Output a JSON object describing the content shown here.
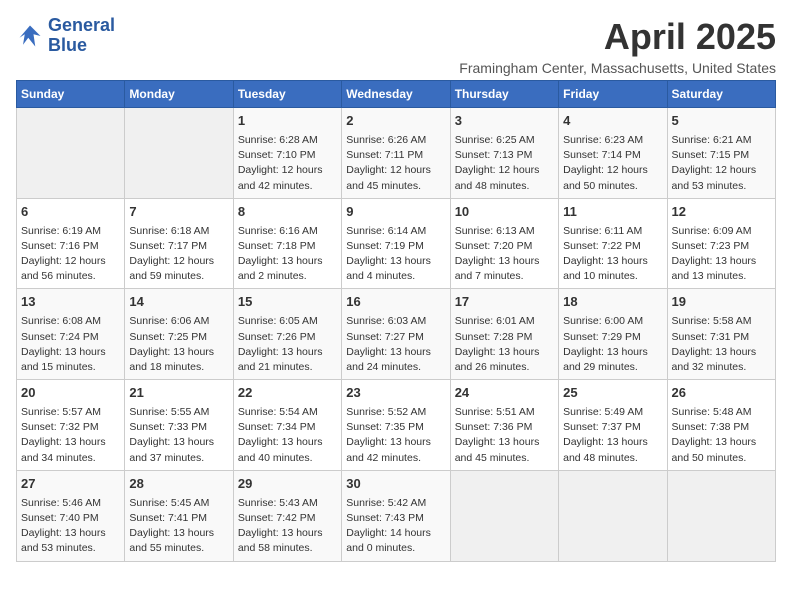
{
  "header": {
    "logo_line1": "General",
    "logo_line2": "Blue",
    "month": "April 2025",
    "location": "Framingham Center, Massachusetts, United States"
  },
  "days_of_week": [
    "Sunday",
    "Monday",
    "Tuesday",
    "Wednesday",
    "Thursday",
    "Friday",
    "Saturday"
  ],
  "weeks": [
    [
      {
        "num": "",
        "empty": true
      },
      {
        "num": "",
        "empty": true
      },
      {
        "num": "1",
        "sunrise": "Sunrise: 6:28 AM",
        "sunset": "Sunset: 7:10 PM",
        "daylight": "Daylight: 12 hours and 42 minutes."
      },
      {
        "num": "2",
        "sunrise": "Sunrise: 6:26 AM",
        "sunset": "Sunset: 7:11 PM",
        "daylight": "Daylight: 12 hours and 45 minutes."
      },
      {
        "num": "3",
        "sunrise": "Sunrise: 6:25 AM",
        "sunset": "Sunset: 7:13 PM",
        "daylight": "Daylight: 12 hours and 48 minutes."
      },
      {
        "num": "4",
        "sunrise": "Sunrise: 6:23 AM",
        "sunset": "Sunset: 7:14 PM",
        "daylight": "Daylight: 12 hours and 50 minutes."
      },
      {
        "num": "5",
        "sunrise": "Sunrise: 6:21 AM",
        "sunset": "Sunset: 7:15 PM",
        "daylight": "Daylight: 12 hours and 53 minutes."
      }
    ],
    [
      {
        "num": "6",
        "sunrise": "Sunrise: 6:19 AM",
        "sunset": "Sunset: 7:16 PM",
        "daylight": "Daylight: 12 hours and 56 minutes."
      },
      {
        "num": "7",
        "sunrise": "Sunrise: 6:18 AM",
        "sunset": "Sunset: 7:17 PM",
        "daylight": "Daylight: 12 hours and 59 minutes."
      },
      {
        "num": "8",
        "sunrise": "Sunrise: 6:16 AM",
        "sunset": "Sunset: 7:18 PM",
        "daylight": "Daylight: 13 hours and 2 minutes."
      },
      {
        "num": "9",
        "sunrise": "Sunrise: 6:14 AM",
        "sunset": "Sunset: 7:19 PM",
        "daylight": "Daylight: 13 hours and 4 minutes."
      },
      {
        "num": "10",
        "sunrise": "Sunrise: 6:13 AM",
        "sunset": "Sunset: 7:20 PM",
        "daylight": "Daylight: 13 hours and 7 minutes."
      },
      {
        "num": "11",
        "sunrise": "Sunrise: 6:11 AM",
        "sunset": "Sunset: 7:22 PM",
        "daylight": "Daylight: 13 hours and 10 minutes."
      },
      {
        "num": "12",
        "sunrise": "Sunrise: 6:09 AM",
        "sunset": "Sunset: 7:23 PM",
        "daylight": "Daylight: 13 hours and 13 minutes."
      }
    ],
    [
      {
        "num": "13",
        "sunrise": "Sunrise: 6:08 AM",
        "sunset": "Sunset: 7:24 PM",
        "daylight": "Daylight: 13 hours and 15 minutes."
      },
      {
        "num": "14",
        "sunrise": "Sunrise: 6:06 AM",
        "sunset": "Sunset: 7:25 PM",
        "daylight": "Daylight: 13 hours and 18 minutes."
      },
      {
        "num": "15",
        "sunrise": "Sunrise: 6:05 AM",
        "sunset": "Sunset: 7:26 PM",
        "daylight": "Daylight: 13 hours and 21 minutes."
      },
      {
        "num": "16",
        "sunrise": "Sunrise: 6:03 AM",
        "sunset": "Sunset: 7:27 PM",
        "daylight": "Daylight: 13 hours and 24 minutes."
      },
      {
        "num": "17",
        "sunrise": "Sunrise: 6:01 AM",
        "sunset": "Sunset: 7:28 PM",
        "daylight": "Daylight: 13 hours and 26 minutes."
      },
      {
        "num": "18",
        "sunrise": "Sunrise: 6:00 AM",
        "sunset": "Sunset: 7:29 PM",
        "daylight": "Daylight: 13 hours and 29 minutes."
      },
      {
        "num": "19",
        "sunrise": "Sunrise: 5:58 AM",
        "sunset": "Sunset: 7:31 PM",
        "daylight": "Daylight: 13 hours and 32 minutes."
      }
    ],
    [
      {
        "num": "20",
        "sunrise": "Sunrise: 5:57 AM",
        "sunset": "Sunset: 7:32 PM",
        "daylight": "Daylight: 13 hours and 34 minutes."
      },
      {
        "num": "21",
        "sunrise": "Sunrise: 5:55 AM",
        "sunset": "Sunset: 7:33 PM",
        "daylight": "Daylight: 13 hours and 37 minutes."
      },
      {
        "num": "22",
        "sunrise": "Sunrise: 5:54 AM",
        "sunset": "Sunset: 7:34 PM",
        "daylight": "Daylight: 13 hours and 40 minutes."
      },
      {
        "num": "23",
        "sunrise": "Sunrise: 5:52 AM",
        "sunset": "Sunset: 7:35 PM",
        "daylight": "Daylight: 13 hours and 42 minutes."
      },
      {
        "num": "24",
        "sunrise": "Sunrise: 5:51 AM",
        "sunset": "Sunset: 7:36 PM",
        "daylight": "Daylight: 13 hours and 45 minutes."
      },
      {
        "num": "25",
        "sunrise": "Sunrise: 5:49 AM",
        "sunset": "Sunset: 7:37 PM",
        "daylight": "Daylight: 13 hours and 48 minutes."
      },
      {
        "num": "26",
        "sunrise": "Sunrise: 5:48 AM",
        "sunset": "Sunset: 7:38 PM",
        "daylight": "Daylight: 13 hours and 50 minutes."
      }
    ],
    [
      {
        "num": "27",
        "sunrise": "Sunrise: 5:46 AM",
        "sunset": "Sunset: 7:40 PM",
        "daylight": "Daylight: 13 hours and 53 minutes."
      },
      {
        "num": "28",
        "sunrise": "Sunrise: 5:45 AM",
        "sunset": "Sunset: 7:41 PM",
        "daylight": "Daylight: 13 hours and 55 minutes."
      },
      {
        "num": "29",
        "sunrise": "Sunrise: 5:43 AM",
        "sunset": "Sunset: 7:42 PM",
        "daylight": "Daylight: 13 hours and 58 minutes."
      },
      {
        "num": "30",
        "sunrise": "Sunrise: 5:42 AM",
        "sunset": "Sunset: 7:43 PM",
        "daylight": "Daylight: 14 hours and 0 minutes."
      },
      {
        "num": "",
        "empty": true
      },
      {
        "num": "",
        "empty": true
      },
      {
        "num": "",
        "empty": true
      }
    ]
  ]
}
